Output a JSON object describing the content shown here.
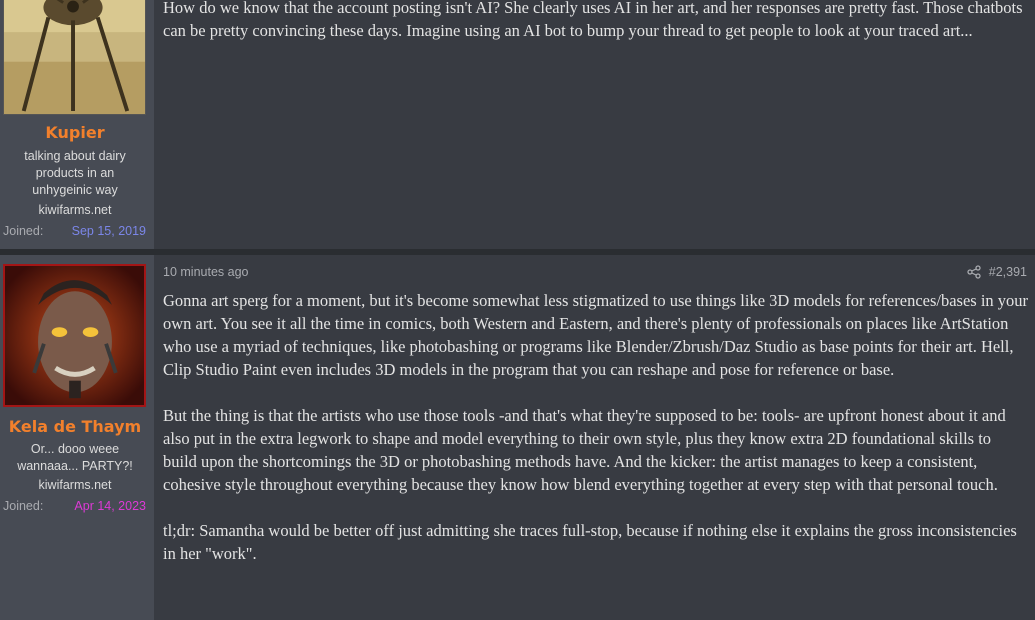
{
  "posts": [
    {
      "username": "Kupier",
      "user_title": "talking about dairy products in an unhygeinic way",
      "site": "kiwifarms.net",
      "joined_label": "Joined:",
      "joined_date": "Sep 15, 2019",
      "avatar_icon": "war-machine-tripod-avatar",
      "paragraphs": [
        "How do we know that the account posting isn't AI? She clearly uses AI in her art, and her responses are pretty fast. Those chatbots can be pretty convincing these days. Imagine using an AI bot to bump your thread to get people to look at your traced art..."
      ]
    },
    {
      "username": "Kela de Thaym",
      "user_title": "Or... dooo weee wannaaa... PARTY?!",
      "site": "kiwifarms.net",
      "joined_label": "Joined:",
      "joined_date": "Apr 14, 2023",
      "avatar_icon": "cyborg-face-avatar",
      "time": "10 minutes ago",
      "share_icon": "share-icon",
      "post_number": "#2,391",
      "paragraphs": [
        "Gonna art sperg for a moment, but it's become somewhat less stigmatized to use things like 3D models for references/bases in your own art. You see it all the time in comics, both Western and Eastern, and there's plenty of professionals on places like ArtStation who use a myriad of techniques, like photobashing or programs like Blender/Zbrush/Daz Studio as base points for their art. Hell, Clip Studio Paint even includes 3D models in the program that you can reshape and pose for reference or base.",
        "But the thing is that the artists who use those tools -and that's what they're supposed to be: tools- are upfront honest about it and also put in the extra legwork to shape and model everything to their own style, plus they know extra 2D foundational skills to build upon the shortcomings the 3D or photobashing methods have. And the kicker: the artist manages to keep a consistent, cohesive style throughout everything because they know how blend everything together at every step with that personal touch.",
        "tl;dr: Samantha would be better off just admitting she traces full-stop, because if nothing else it explains the gross inconsistencies in her \"work\"."
      ]
    }
  ],
  "colors": {
    "username": "#f2802c",
    "joined_date_1": "#7b86e8",
    "joined_date_2": "#dd3ad6",
    "post_bg": "#383b42",
    "user_col_bg": "#474b54"
  }
}
